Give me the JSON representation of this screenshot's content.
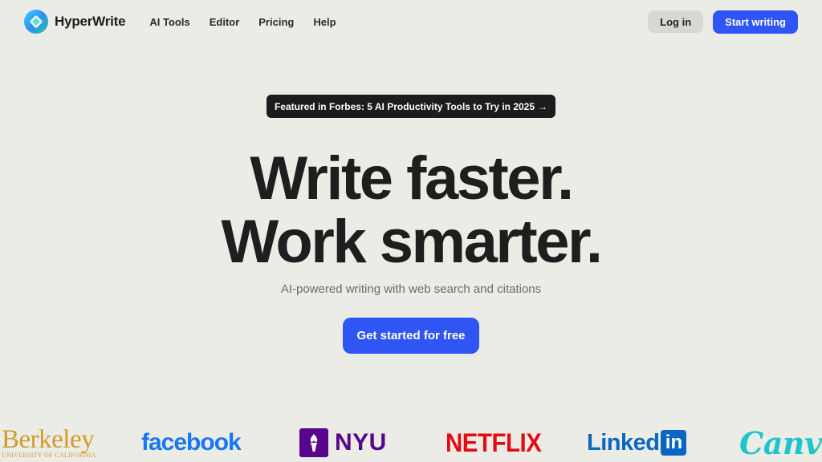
{
  "header": {
    "brand_name": "HyperWrite",
    "nav_links": [
      "AI Tools",
      "Editor",
      "Pricing",
      "Help"
    ],
    "login_label": "Log in",
    "start_label": "Start writing"
  },
  "hero": {
    "featured_text": "Featured in Forbes: 5 AI Productivity Tools to Try in 2025",
    "featured_arrow": "→",
    "headline_line1": "Write faster.",
    "headline_line2": "Work smarter.",
    "subtitle": "AI-powered writing with web search and citations",
    "cta_label": "Get started for free"
  },
  "customer_logos": {
    "berkeley": "Berkeley",
    "berkeley_sub": "UNIVERSITY OF CALIFORNIA",
    "facebook": "facebook",
    "nyu": "NYU",
    "netflix": "NETFLIX",
    "linkedin": "Linked",
    "linkedin_box": "in",
    "canva": "Canva"
  },
  "colors": {
    "background": "#ecece7",
    "accent": "#2f55f5",
    "dark": "#1c1c1c"
  }
}
